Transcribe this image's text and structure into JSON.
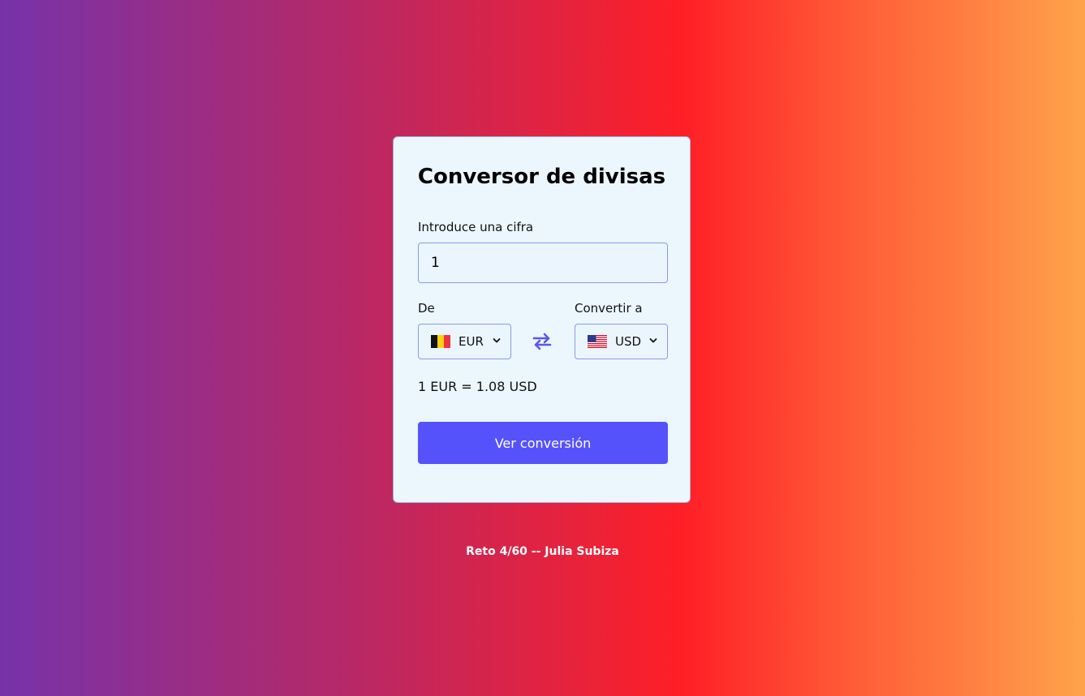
{
  "converter": {
    "title": "Conversor de divisas",
    "amount_label": "Introduce una cifra",
    "amount_value": "1",
    "from_label": "De",
    "to_label": "Convertir a",
    "from_currency": "EUR",
    "to_currency": "USD",
    "from_flag": "belgium-flag-icon",
    "to_flag": "usa-flag-icon",
    "swap_icon": "swap-arrows-icon",
    "rate_text": "1 EUR = 1.08 USD",
    "submit_label": "Ver conversión"
  },
  "footer": {
    "text": "Reto 4/60 -- Julia Subiza"
  },
  "colors": {
    "card_bg": "#ebf6fd",
    "accent": "#5652fb",
    "input_border": "#8b9be3"
  }
}
